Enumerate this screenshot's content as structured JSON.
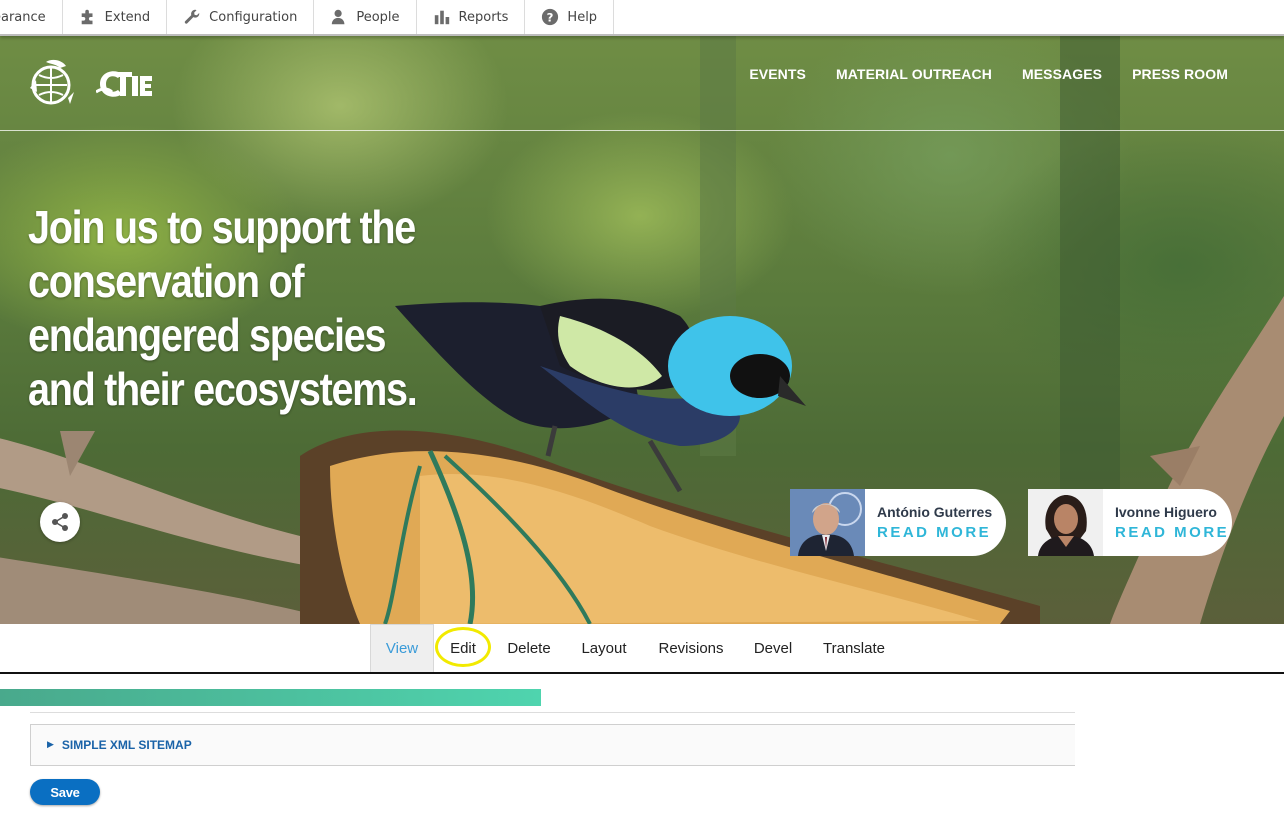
{
  "toolbar": {
    "items": [
      {
        "label": "earance",
        "icon": "appearance-icon"
      },
      {
        "label": "Extend",
        "icon": "puzzle-icon"
      },
      {
        "label": "Configuration",
        "icon": "wrench-icon"
      },
      {
        "label": "People",
        "icon": "person-icon"
      },
      {
        "label": "Reports",
        "icon": "bar-chart-icon"
      },
      {
        "label": "Help",
        "icon": "help-icon"
      }
    ]
  },
  "site": {
    "nav": [
      "EVENTS",
      "MATERIAL OUTREACH",
      "MESSAGES",
      "PRESS ROOM"
    ],
    "hero_title": "Join us to support the conservation of endangered species and their ecosystems.",
    "people": [
      {
        "name": "António Guterres",
        "link": "READ MORE"
      },
      {
        "name": "Ivonne Higuero",
        "link": "READ MORE"
      }
    ],
    "accent_color": "#2fb6d8"
  },
  "tabs": {
    "items": [
      "View",
      "Edit",
      "Delete",
      "Layout",
      "Revisions",
      "Devel",
      "Translate"
    ],
    "active": "View",
    "highlighted": "Edit"
  },
  "form": {
    "section_label": "SIMPLE XML SITEMAP",
    "save_label": "Save"
  }
}
